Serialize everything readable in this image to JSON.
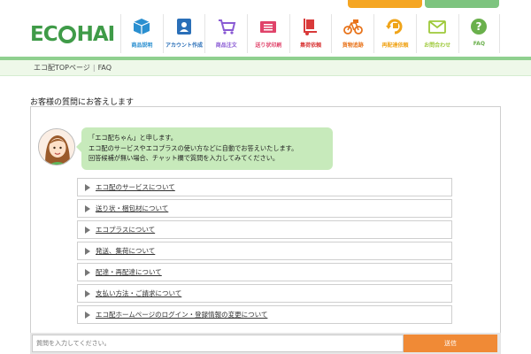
{
  "logo": {
    "text_left": "EC",
    "text_right": "HAI"
  },
  "nav": {
    "items": [
      {
        "label": "商品説明",
        "icon": "box-icon",
        "color": "#2a8fd0"
      },
      {
        "label": "アカウント作成",
        "icon": "id-card-icon",
        "color": "#2a6fb8"
      },
      {
        "label": "商品注文",
        "icon": "cart-icon",
        "color": "#8a5bd4"
      },
      {
        "label": "送り状印刷",
        "icon": "printer-icon",
        "color": "#e0436a"
      },
      {
        "label": "集荷依頼",
        "icon": "delivery-cart-icon",
        "color": "#d93a3a"
      },
      {
        "label": "貨物追跡",
        "icon": "bicycle-icon",
        "color": "#e8731a"
      },
      {
        "label": "再配達依頼",
        "icon": "redelivery-icon",
        "color": "#f0a419"
      },
      {
        "label": "お問合わせ",
        "icon": "mail-icon",
        "color": "#9ec93a"
      },
      {
        "label": "FAQ",
        "icon": "question-icon",
        "color": "#6ab04c"
      }
    ]
  },
  "breadcrumb": {
    "home": "エコ配TOPページ",
    "current": "FAQ"
  },
  "section_title": "お客様の質問にお答えします",
  "bubble": {
    "lines": [
      "「エコ配ちゃん」と申します。",
      "エコ配のサービスやエコプラスの使い方などに自動でお答えいたします。",
      "回答候補が無い場合、チャット欄で質問を入力してみてください。"
    ]
  },
  "faq": [
    "エコ配のサービスについて",
    "送り状・梱包材について",
    "エコプラスについて",
    "発送、集荷について",
    "配達・再配達について",
    "支払い方法・ご請求について",
    "エコ配ホームページのログイン・登録情報の変更について"
  ],
  "chat": {
    "placeholder": "質問を入力してください。",
    "send_label": "送信"
  },
  "colors": {
    "brand_green": "#3f9b48",
    "send_orange": "#f08a36",
    "bubble_green": "#c7eabb"
  }
}
